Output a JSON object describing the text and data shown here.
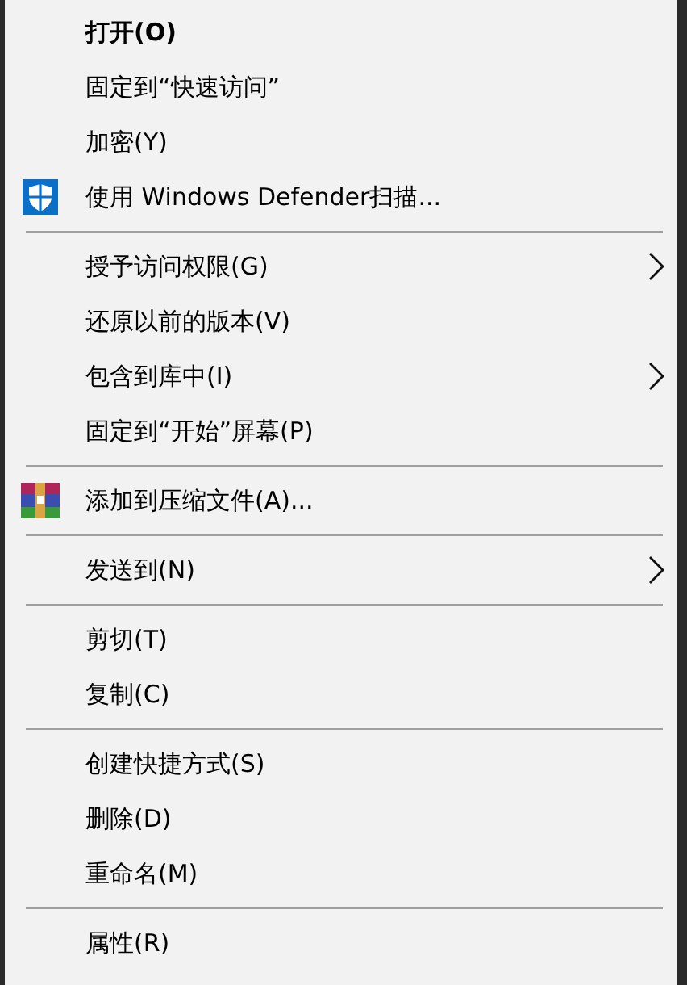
{
  "menu": {
    "groups": [
      {
        "items": [
          {
            "label": "打开(O)",
            "default": true,
            "submenu": false
          },
          {
            "label": "固定到“快速访问”",
            "default": false,
            "submenu": false
          },
          {
            "label": "加密(Y)",
            "default": false,
            "submenu": false
          },
          {
            "label": "使用 Windows Defender扫描...",
            "default": false,
            "submenu": false,
            "kind": "shield"
          }
        ]
      },
      {
        "items": [
          {
            "label": "授予访问权限(G)",
            "default": false,
            "submenu": true
          },
          {
            "label": "还原以前的版本(V)",
            "default": false,
            "submenu": false
          },
          {
            "label": "包含到库中(I)",
            "default": false,
            "submenu": true
          },
          {
            "label": "固定到“开始”屏幕(P)",
            "default": false,
            "submenu": false
          }
        ]
      },
      {
        "items": [
          {
            "label": "添加到压缩文件(A)...",
            "default": false,
            "submenu": false,
            "kind": "archive"
          }
        ]
      },
      {
        "items": [
          {
            "label": "发送到(N)",
            "default": false,
            "submenu": true
          }
        ]
      },
      {
        "items": [
          {
            "label": "剪切(T)",
            "default": false,
            "submenu": false
          },
          {
            "label": "复制(C)",
            "default": false,
            "submenu": false
          }
        ]
      },
      {
        "items": [
          {
            "label": "创建快捷方式(S)",
            "default": false,
            "submenu": false
          },
          {
            "label": "删除(D)",
            "default": false,
            "submenu": false
          },
          {
            "label": "重命名(M)",
            "default": false,
            "submenu": false
          }
        ]
      },
      {
        "items": [
          {
            "label": "属性(R)",
            "default": false,
            "submenu": false
          }
        ]
      }
    ]
  }
}
